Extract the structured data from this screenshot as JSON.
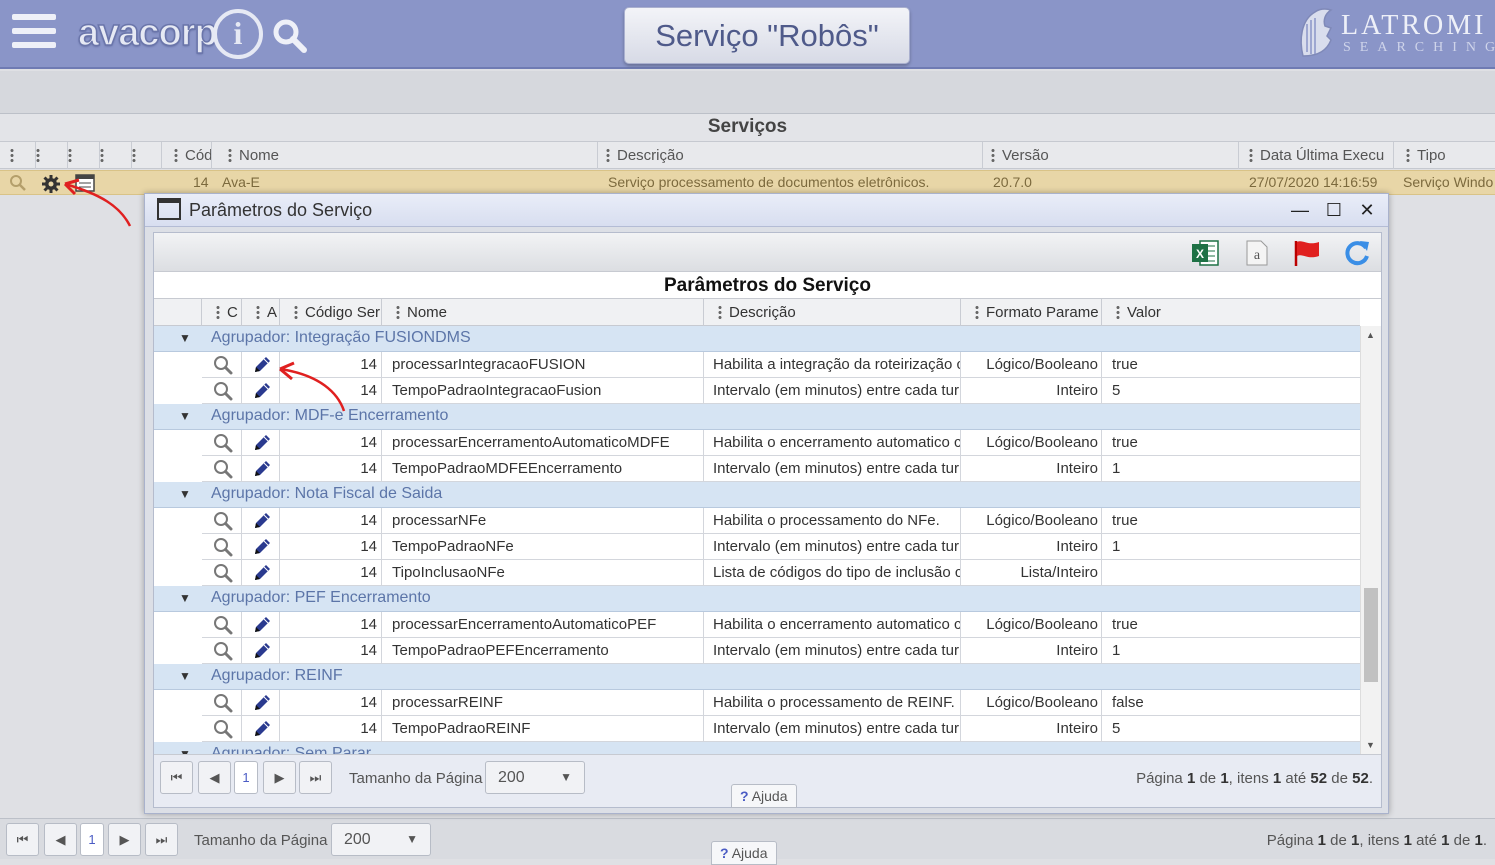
{
  "header": {
    "logo_text": "avacorp",
    "logo_i": "i",
    "title": "Serviço \"Robôs\"",
    "brand_name": "LATROMI",
    "brand_sub": "SEARCHING"
  },
  "services": {
    "title": "Serviços",
    "columns": [
      "Cód",
      "Nome",
      "Descrição",
      "Versão",
      "Data Última Execu",
      "Tipo"
    ],
    "row": {
      "code": "14",
      "name": "Ava-E",
      "description": "Serviço processamento de documentos eletrônicos.",
      "version": "20.7.0",
      "last_run": "27/07/2020 14:16:59",
      "type": "Serviço Windo"
    }
  },
  "dialog": {
    "window_title": "Parâmetros do Serviço",
    "grid_title": "Parâmetros do Serviço",
    "columns": [
      "C",
      "A",
      "Código Ser",
      "Nome",
      "Descrição",
      "Formato Parame",
      "Valor"
    ],
    "toolbar_icons": [
      "excel-export-icon",
      "text-export-icon",
      "flag-icon",
      "refresh-icon"
    ],
    "groups": [
      {
        "label": "Agrupador: Integração FUSIONDMS",
        "rows": [
          {
            "code": "14",
            "name": "processarIntegracaoFUSION",
            "description": "Habilita a integração da roteirização c",
            "format": "Lógico/Booleano",
            "value": "true"
          },
          {
            "code": "14",
            "name": "TempoPadraoIntegracaoFusion",
            "description": "Intervalo (em minutos) entre cada tur",
            "format": "Inteiro",
            "value": "5"
          }
        ]
      },
      {
        "label": "Agrupador: MDF-e Encerramento",
        "rows": [
          {
            "code": "14",
            "name": "processarEncerramentoAutomaticoMDFE",
            "description": "Habilita o encerramento automatico c",
            "format": "Lógico/Booleano",
            "value": "true"
          },
          {
            "code": "14",
            "name": "TempoPadraoMDFEEncerramento",
            "description": "Intervalo (em minutos) entre cada tur",
            "format": "Inteiro",
            "value": "1"
          }
        ]
      },
      {
        "label": "Agrupador: Nota Fiscal de Saida",
        "rows": [
          {
            "code": "14",
            "name": "processarNFe",
            "description": "Habilita o processamento do NFe.",
            "format": "Lógico/Booleano",
            "value": "true"
          },
          {
            "code": "14",
            "name": "TempoPadraoNFe",
            "description": "Intervalo (em minutos) entre cada tur",
            "format": "Inteiro",
            "value": "1"
          },
          {
            "code": "14",
            "name": "TipoInclusaoNFe",
            "description": "Lista de códigos do tipo de inclusão c",
            "format": "Lista/Inteiro",
            "value": ""
          }
        ]
      },
      {
        "label": "Agrupador: PEF Encerramento",
        "rows": [
          {
            "code": "14",
            "name": "processarEncerramentoAutomaticoPEF",
            "description": "Habilita o encerramento automatico c",
            "format": "Lógico/Booleano",
            "value": "true"
          },
          {
            "code": "14",
            "name": "TempoPadraoPEFEncerramento",
            "description": "Intervalo (em minutos) entre cada tur",
            "format": "Inteiro",
            "value": "1"
          }
        ]
      },
      {
        "label": "Agrupador: REINF",
        "rows": [
          {
            "code": "14",
            "name": "processarREINF",
            "description": "Habilita o processamento de REINF.",
            "format": "Lógico/Booleano",
            "value": "false"
          },
          {
            "code": "14",
            "name": "TempoPadraoREINF",
            "description": "Intervalo (em minutos) entre cada tur",
            "format": "Inteiro",
            "value": "5"
          }
        ]
      },
      {
        "label": "Agrupador: Sem Parar",
        "rows": []
      }
    ],
    "pager": {
      "current_page": "1",
      "page_size_label": "Tamanho da Página",
      "page_size": "200",
      "info_prefix": "Página",
      "page": "1",
      "of": "de",
      "pages": "1",
      "items_label": ", itens",
      "from": "1",
      "to_label": "até",
      "to": "52",
      "total": "52",
      "end": "."
    },
    "help_label": "Ajuda"
  },
  "pager": {
    "current_page": "1",
    "page_size_label": "Tamanho da Página",
    "page_size": "200",
    "info_prefix": "Página",
    "page": "1",
    "of": "de",
    "pages": "1",
    "items_label": ", itens",
    "from": "1",
    "to_label": "até",
    "to": "1",
    "total": "1",
    "end": "."
  },
  "help_label": "Ajuda"
}
